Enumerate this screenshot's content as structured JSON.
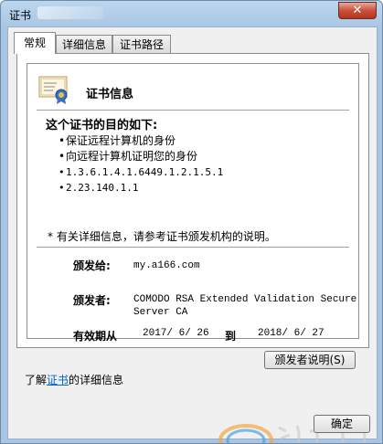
{
  "window": {
    "title": "证书",
    "close_label": "✕"
  },
  "tabs": [
    {
      "label": "常规",
      "active": true
    },
    {
      "label": "详细信息",
      "active": false
    },
    {
      "label": "证书路径",
      "active": false
    }
  ],
  "certificate": {
    "heading": "证书信息",
    "purpose_heading": "这个证书的目的如下:",
    "purposes": [
      "保证远程计算机的身份",
      "向远程计算机证明您的身份",
      "1.3.6.1.4.1.6449.1.2.1.5.1",
      "2.23.140.1.1"
    ],
    "note": "* 有关详细信息，请参考证书颁发机构的说明。",
    "issued_to_label": "颁发给:",
    "issued_to_value": "my.a166.com",
    "issued_by_label": "颁发者:",
    "issued_by_value_line1": "COMODO RSA Extended Validation Secure",
    "issued_by_value_line2": "Server CA",
    "validity_label": "有效期从",
    "valid_from": "2017/ 6/ 26",
    "to_label": "到",
    "valid_to": "2018/ 6/ 27"
  },
  "buttons": {
    "issuer_statement": "颁发者说明(S)",
    "ok": "确定"
  },
  "footer": {
    "prefix": "了解",
    "link": "证书",
    "suffix": "的详细信息"
  },
  "colors": {
    "link": "#0066cc",
    "titlebar": "#a8c6e4",
    "close_button": "#c9503d"
  }
}
